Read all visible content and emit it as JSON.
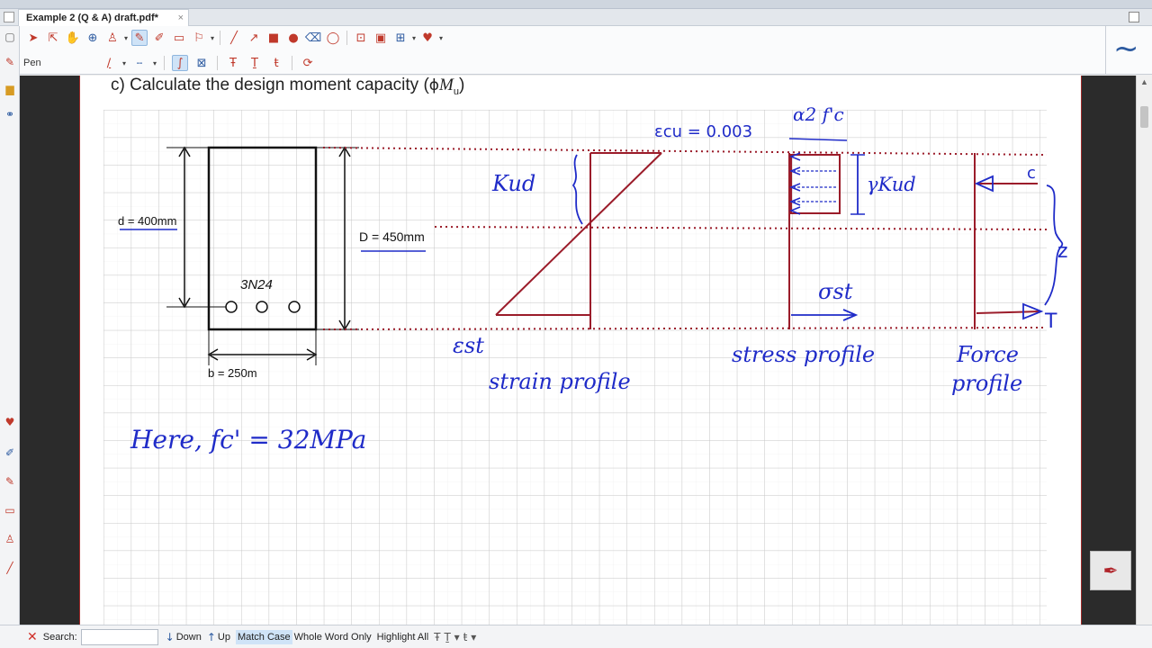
{
  "window": {
    "tab_title": "Example 2 (Q & A) draft.pdf*",
    "tab_close": "×"
  },
  "toolbar": {
    "tool_label": "Pen",
    "pen_color": "#c0392b",
    "right_logo": "~"
  },
  "document": {
    "heading_prefix": "c) Calculate the design moment capacity (",
    "heading_symbol": "ϕ",
    "heading_var": "M",
    "heading_sub": "u",
    "heading_suffix": ")",
    "section": {
      "d_label": "d = 400mm",
      "D_label": "D = 450mm",
      "b_label": "b = 250m",
      "bars_label": "3N24"
    },
    "handwriting": {
      "ecu": "εcu = 0.003",
      "kud": "Kud",
      "alpha_fc": "α2 f'c",
      "gamma_kud": "γKud",
      "c_label": "c",
      "z_label": "z",
      "t_label": "T",
      "sigma_st": "σst",
      "eps_st": "εst",
      "strain_profile": "strain profile",
      "stress_profile": "stress profile",
      "force_profile_1": "Force",
      "force_profile_2": "profile",
      "given": "Here,  fc' = 32MPa"
    },
    "ink_blue": "#1f2bc8",
    "ink_red": "#9b1c2a"
  },
  "findbar": {
    "search_label": "Search:",
    "search_value": "",
    "down": "Down",
    "up": "Up",
    "match_case": "Match Case",
    "whole_word": "Whole Word Only",
    "highlight_all": "Highlight All"
  }
}
